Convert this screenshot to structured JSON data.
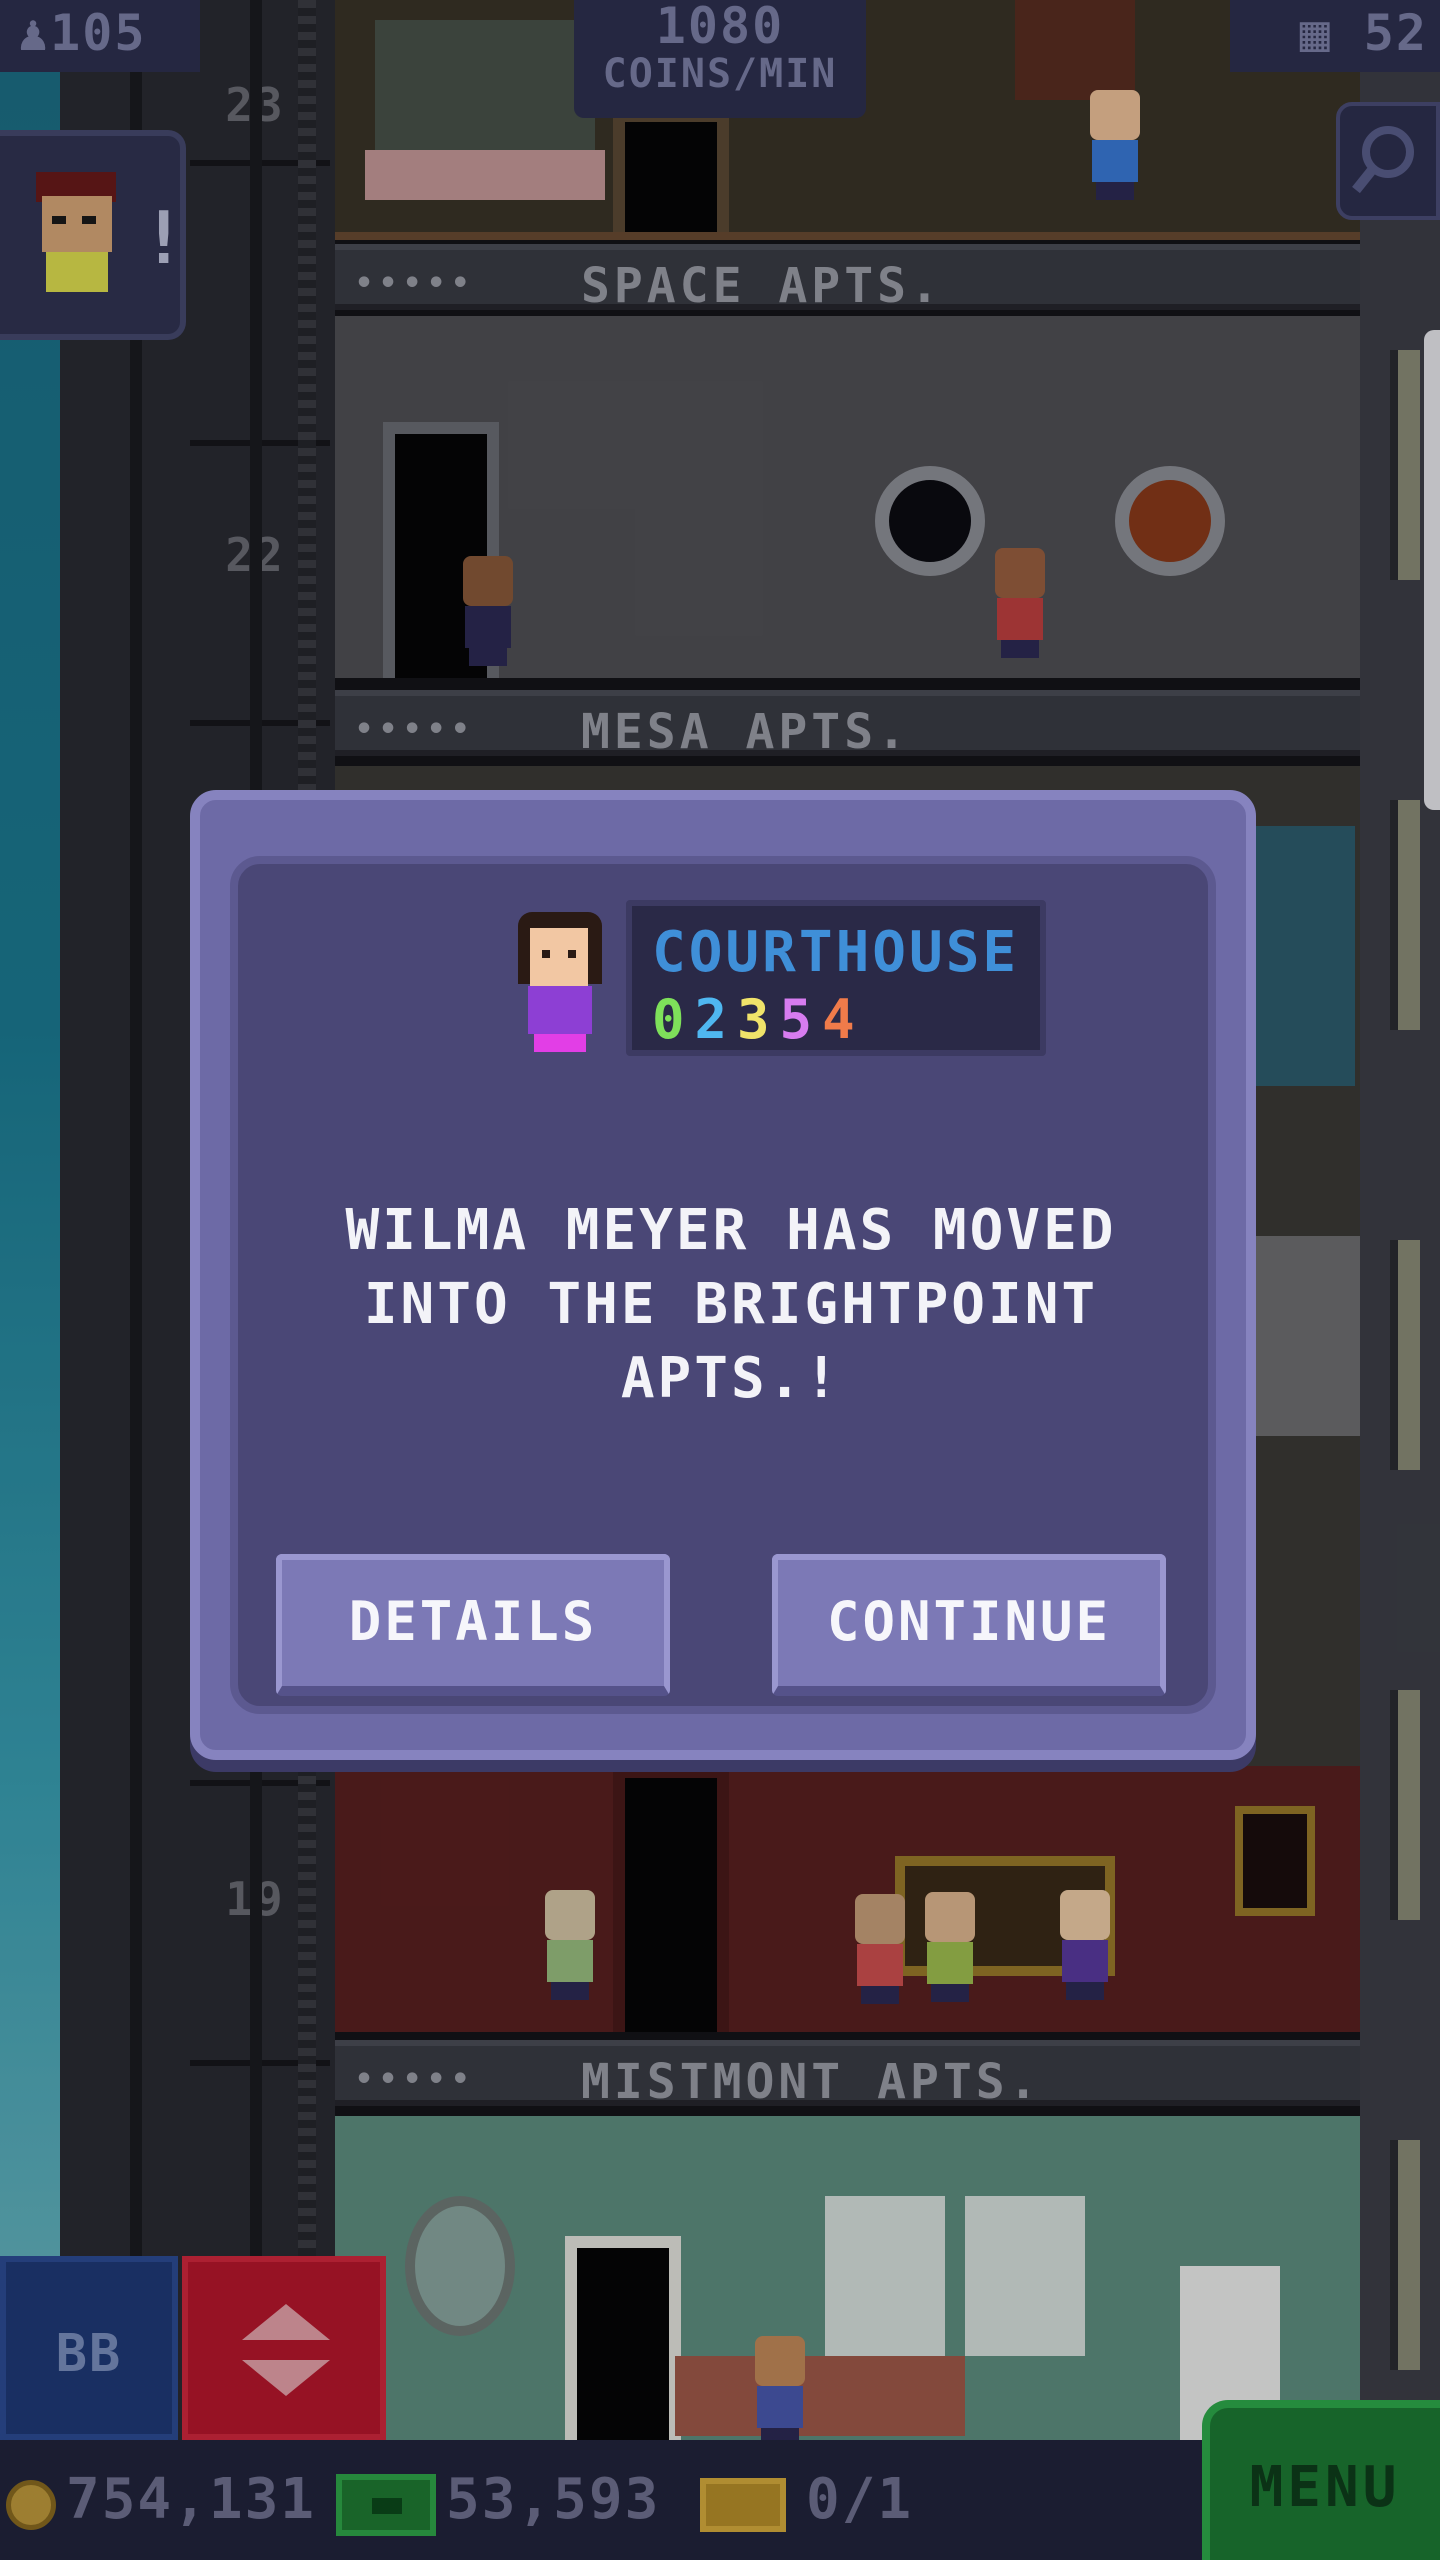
{
  "hud": {
    "population": "105",
    "coins_per_min_value": "1080",
    "coins_per_min_label": "COINS/MIN",
    "floors": "52"
  },
  "floors": {
    "labels": [
      "SPACE APTS.",
      "MESA APTS.",
      "MISTMONT APTS."
    ],
    "numbers": [
      "23",
      "22",
      "19"
    ],
    "occupancy_dots": "•••••"
  },
  "dialog": {
    "dream_job": "COURTHOUSE",
    "skills": [
      {
        "value": "0",
        "color": "#7ee05a"
      },
      {
        "value": "2",
        "color": "#4fb7f0"
      },
      {
        "value": "3",
        "color": "#f0e36a"
      },
      {
        "value": "5",
        "color": "#d77cf0"
      },
      {
        "value": "4",
        "color": "#f07b4a"
      }
    ],
    "message_line1": "WILMA MEYER HAS MOVED",
    "message_line2": "INTO THE BRIGHTPOINT APTS.!",
    "details_label": "DETAILS",
    "continue_label": "CONTINUE"
  },
  "bottom": {
    "bb_label": "BB",
    "coins": "754,131",
    "tower_bux": "53,593",
    "tickets": "0/1",
    "menu_label": "MENU"
  },
  "icons": {
    "population": "person-icon",
    "floors": "building-icon",
    "search": "magnifier-icon",
    "elevator": "up-down-arrows-icon",
    "coins": "coin-icon",
    "bux": "tower-bux-icon",
    "tickets": "ticket-icon"
  },
  "colors": {
    "dialog": "#6d6aa6",
    "dialog_inner": "#4a4776",
    "button": "#7c79b6",
    "dream_job": "#3f8fd8",
    "menu": "#1d7a34",
    "elevator_button": "#b8162c"
  }
}
